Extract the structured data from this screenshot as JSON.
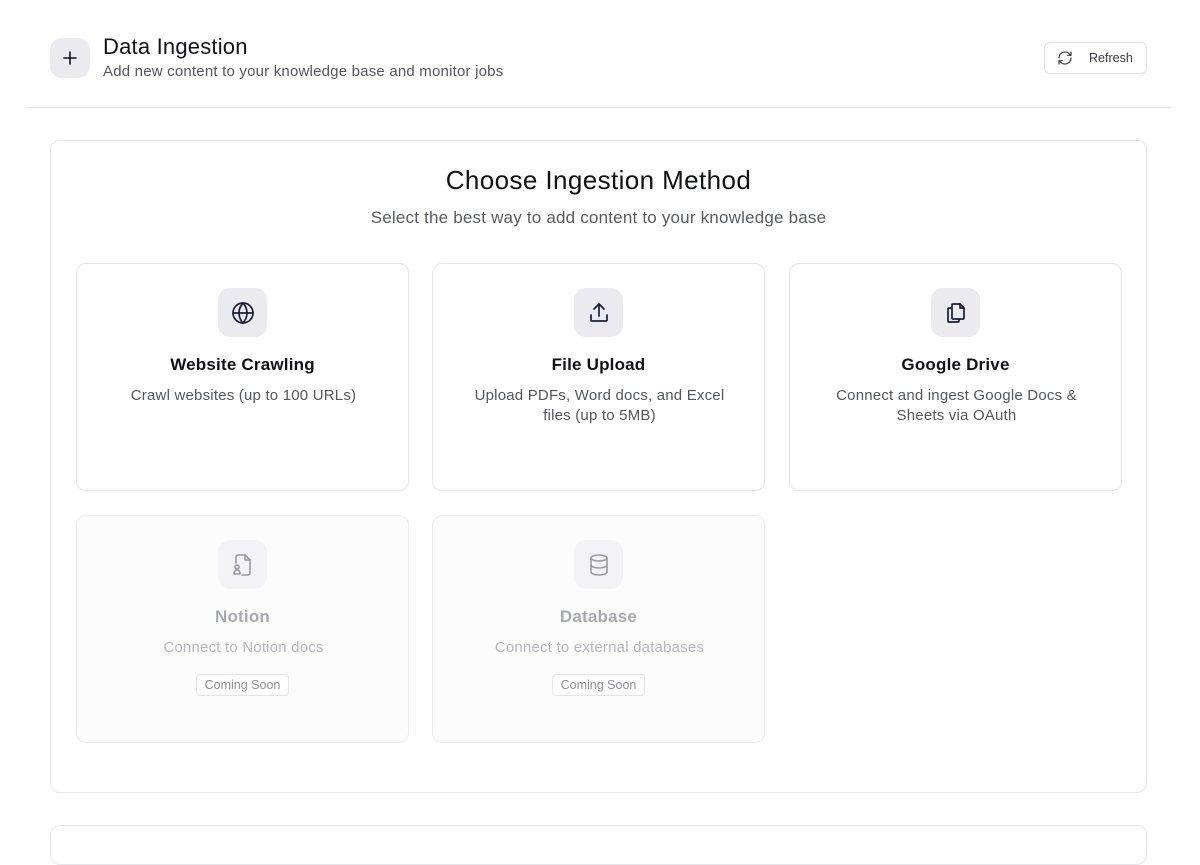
{
  "header": {
    "icon": "plus-icon",
    "title": "Data Ingestion",
    "subtitle": "Add new content to your knowledge base and monitor jobs",
    "refresh_label": "Refresh",
    "refresh_icon": "refresh-icon"
  },
  "panel": {
    "title": "Choose Ingestion Method",
    "subtitle": "Select the best way to add content to your knowledge base"
  },
  "methods": [
    {
      "icon": "globe-icon",
      "title": "Website Crawling",
      "description": "Crawl websites (up to 100 URLs)",
      "enabled": true
    },
    {
      "icon": "upload-icon",
      "title": "File Upload",
      "description": "Upload PDFs, Word docs, and Excel files (up to 5MB)",
      "enabled": true
    },
    {
      "icon": "copy-files-icon",
      "title": "Google Drive",
      "description": "Connect and ingest Google Docs & Sheets via OAuth",
      "enabled": true
    },
    {
      "icon": "file-user-icon",
      "title": "Notion",
      "description": "Connect to Notion docs",
      "enabled": false,
      "badge": "Coming Soon"
    },
    {
      "icon": "database-icon",
      "title": "Database",
      "description": "Connect to external databases",
      "enabled": false,
      "badge": "Coming Soon"
    }
  ],
  "colors": {
    "text_primary": "#111118",
    "text_secondary": "#55565e",
    "text_disabled": "#a8a9ae",
    "icon_bg": "#ebebef",
    "border": "#e4e4e8"
  }
}
